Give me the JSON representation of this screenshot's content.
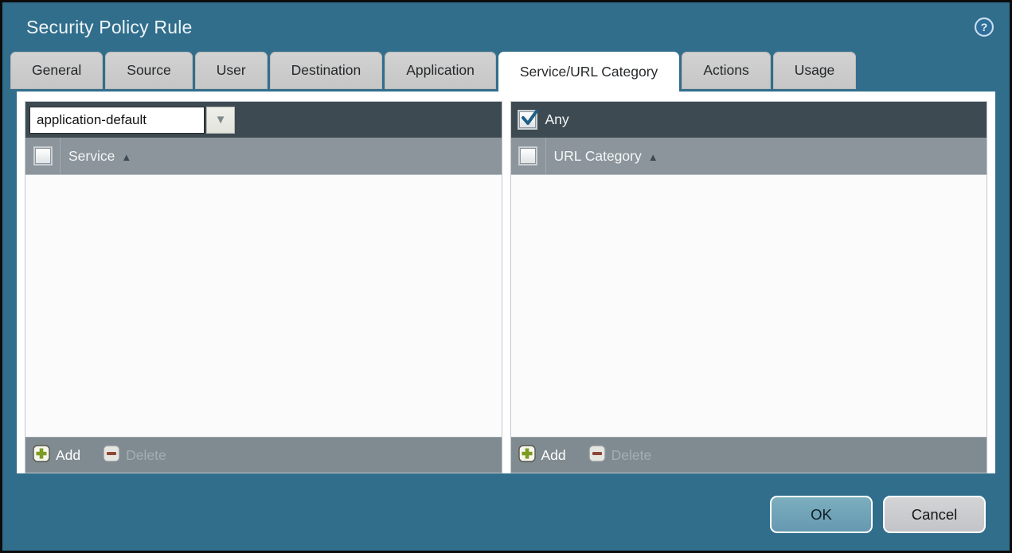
{
  "window": {
    "title": "Security Policy Rule"
  },
  "tabs": {
    "items": [
      {
        "label": "General"
      },
      {
        "label": "Source"
      },
      {
        "label": "User"
      },
      {
        "label": "Destination"
      },
      {
        "label": "Application"
      },
      {
        "label": "Service/URL Category"
      },
      {
        "label": "Actions"
      },
      {
        "label": "Usage"
      }
    ],
    "active": "Service/URL Category"
  },
  "service_panel": {
    "combo_value": "application-default",
    "column_header": "Service",
    "rows": [],
    "add_label": "Add",
    "delete_label": "Delete",
    "delete_enabled": false
  },
  "url_category_panel": {
    "any_label": "Any",
    "any_checked": true,
    "column_header": "URL Category",
    "rows": [],
    "add_label": "Add",
    "delete_label": "Delete",
    "delete_enabled": false
  },
  "dialog_buttons": {
    "ok_label": "OK",
    "cancel_label": "Cancel"
  },
  "glyphs": {
    "sort_asc": "▲",
    "dropdown_caret": "▼",
    "help": "?"
  },
  "colors": {
    "titlebar_teal": "#316e8c",
    "panel_toolbar_dark": "#3e4a52",
    "column_header_gray": "#8c959b",
    "panel_footer_gray": "#808b91",
    "ok_button": "#71a2b9",
    "cancel_button": "#c9cacd",
    "add_icon_green": "#7e9b21",
    "delete_icon_red": "#8f4438",
    "check_blue": "#1f5f85"
  }
}
